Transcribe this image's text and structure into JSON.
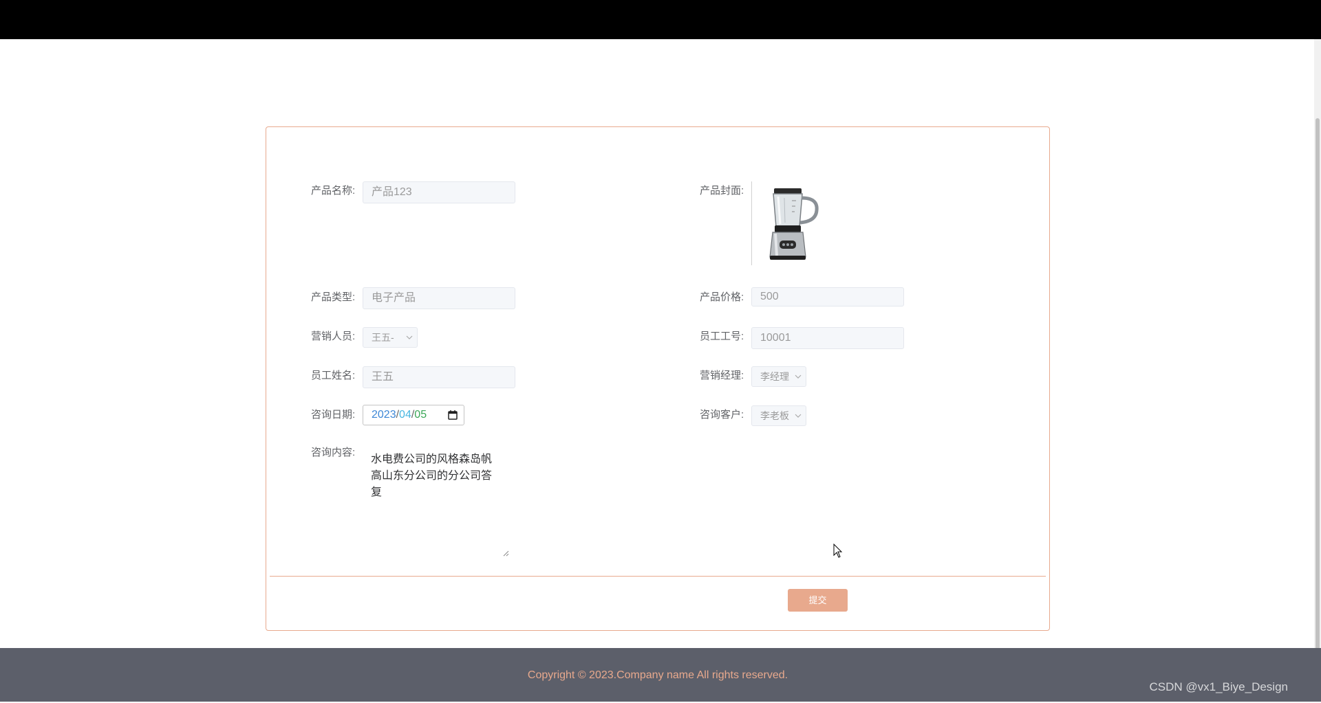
{
  "form": {
    "product_name": {
      "label": "产品名称:",
      "value": "产品123"
    },
    "product_cover": {
      "label": "产品封面:"
    },
    "product_type": {
      "label": "产品类型:",
      "value": "电子产品"
    },
    "product_price": {
      "label": "产品价格:",
      "value": "500"
    },
    "sales_person": {
      "label": "营销人员:",
      "value": "王五-"
    },
    "employee_no": {
      "label": "员工工号:",
      "value": "10001"
    },
    "employee_name": {
      "label": "员工姓名:",
      "value": "王五"
    },
    "sales_manager": {
      "label": "营销经理:",
      "value": "李经理"
    },
    "consult_date": {
      "label": "咨询日期:",
      "year": "2023",
      "month": "04",
      "day": "05",
      "sep": "/"
    },
    "consult_customer": {
      "label": "咨询客户:",
      "value": "李老板"
    },
    "consult_content": {
      "label": "咨询内容:",
      "value": "水电费公司的风格森岛帆高山东分公司的分公司答复"
    },
    "submit_label": "提交"
  },
  "footer": {
    "copyright": "Copyright © 2023.Company name All rights reserved."
  },
  "watermark": "CSDN @vx1_Biye_Design",
  "colors": {
    "accent": "#e8a98d",
    "footer_bg": "#5c5f6a",
    "topbar": "#000000"
  },
  "icons": [
    "chevron-down-icon",
    "calendar-icon",
    "resize-handle-icon",
    "mouse-cursor-icon",
    "blender-image"
  ]
}
